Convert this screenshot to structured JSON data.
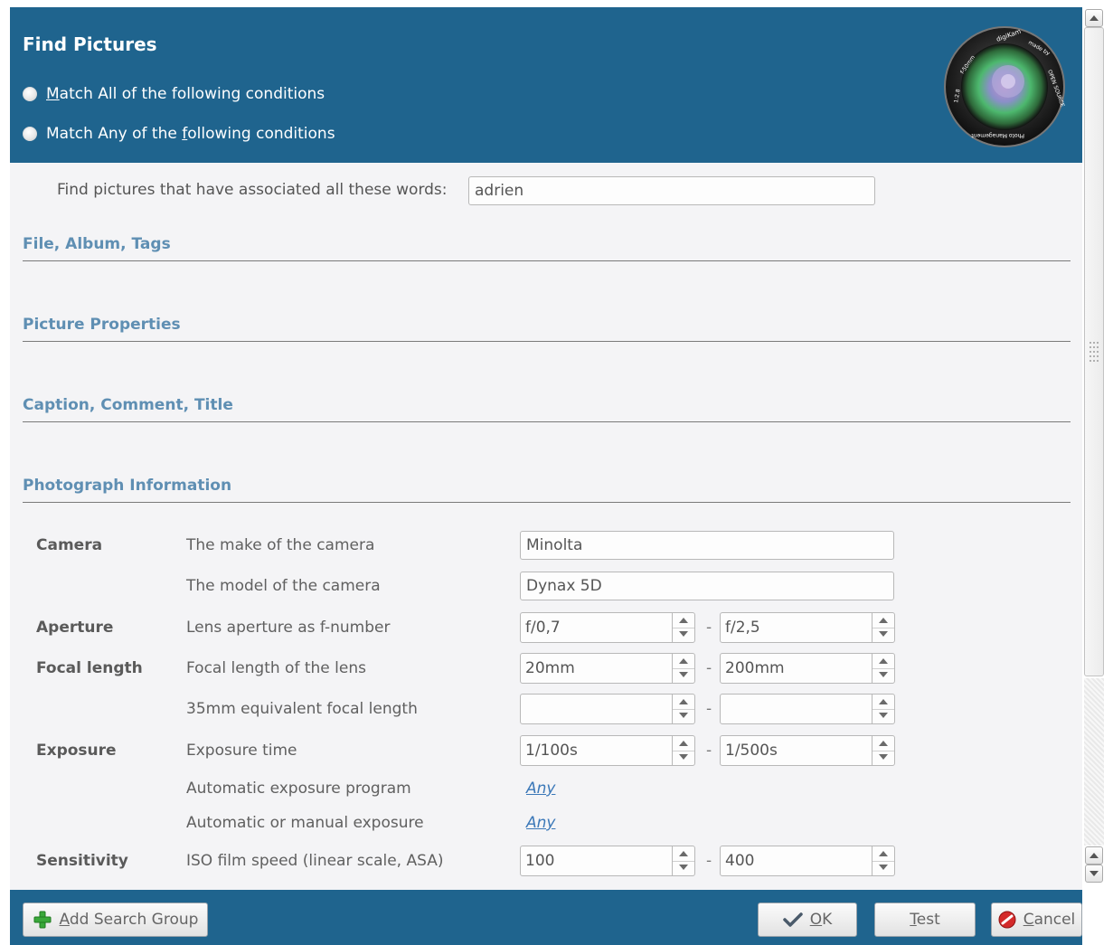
{
  "dialog": {
    "title": "Find Pictures"
  },
  "match": {
    "all": {
      "prefix": "",
      "accel": "M",
      "rest": "atch All of the following conditions"
    },
    "any": {
      "prefix": "Match Any of the ",
      "accel": "f",
      "rest": "ollowing conditions"
    }
  },
  "keywords": {
    "label": "Find pictures that have associated all these words:",
    "value": "adrien"
  },
  "sections": {
    "file_album_tags": "File, Album, Tags",
    "picture_properties": "Picture Properties",
    "caption": "Caption, Comment, Title",
    "photograph_info": "Photograph Information"
  },
  "photo": {
    "camera_head": "Camera",
    "make_label": "The make of the camera",
    "make_value": "Minolta",
    "model_label": "The model of the camera",
    "model_value": "Dynax 5D",
    "aperture_head": "Aperture",
    "aperture_label": "Lens aperture as f-number",
    "aperture_from": "f/0,7",
    "aperture_to": "f/2,5",
    "focal_head": "Focal length",
    "focal_label": "Focal length of the lens",
    "focal_from": "20mm",
    "focal_to": "200mm",
    "focal35_label": "35mm equivalent focal length",
    "focal35_from": "",
    "focal35_to": "",
    "exposure_head": "Exposure",
    "exposure_time_label": "Exposure time",
    "exposure_from": "1/100s",
    "exposure_to": "1/500s",
    "exposure_program_label": "Automatic exposure program",
    "exposure_program_value": "Any",
    "exposure_mode_label": "Automatic or manual exposure",
    "exposure_mode_value": "Any",
    "sensitivity_head": "Sensitivity",
    "iso_label": "ISO film speed (linear scale, ASA)",
    "iso_from": "100",
    "iso_to": "400",
    "range_dash": "-"
  },
  "footer": {
    "add_group": {
      "accel": "A",
      "rest": "dd Search Group"
    },
    "ok": {
      "accel": "O",
      "rest": "K"
    },
    "test": {
      "accel": "T",
      "rest": "est"
    },
    "cancel": {
      "accel": "C",
      "rest": "ancel"
    }
  },
  "logo": {
    "text_top": "digiKam",
    "text_made_by": "made by",
    "text_open_source": "OPEN SOURCE",
    "text_focal": "1:2.8",
    "text_fl": "f-50mm",
    "text_bottom": "Photo Management"
  },
  "colors": {
    "header": "#1f648e",
    "section_title": "#5f8fb3",
    "link": "#3b78b8"
  },
  "icons": [
    "add-icon",
    "check-icon",
    "cancel-icon",
    "digikam-logo"
  ]
}
